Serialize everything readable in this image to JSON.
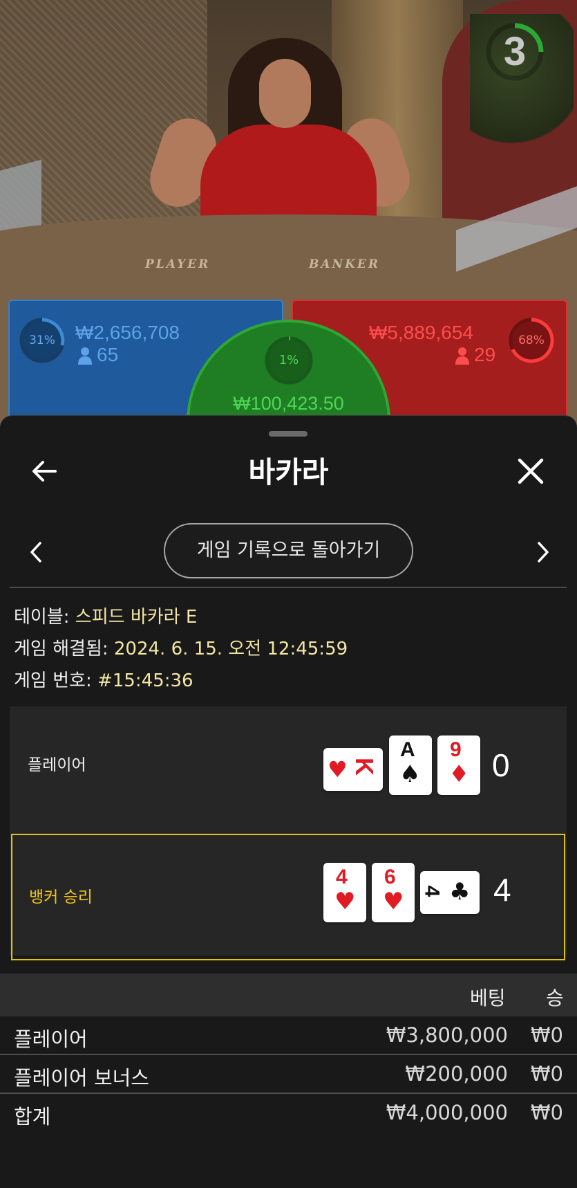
{
  "stage": {
    "countdown": "3",
    "table_labels": {
      "player": "PLAYER",
      "banker": "BANKER"
    },
    "player_pool": {
      "percent": "31%",
      "amount": "₩2,656,708",
      "count": "65"
    },
    "banker_pool": {
      "percent": "68%",
      "amount": "₩5,889,654",
      "count": "29"
    },
    "tie_pool": {
      "percent": "1%",
      "amount": "₩100,423.50"
    }
  },
  "sheet": {
    "title": "바카라",
    "back_icon": "arrow-left-icon",
    "close_icon": "close-icon",
    "return_button": "게임 기록으로 돌아가기",
    "meta": {
      "table_label": "테이블: ",
      "table_value": "스피드 바카라 E",
      "resolved_label": "게임 해결됨: ",
      "resolved_value": "2024. 6. 15. 오전 12:45:59",
      "number_label": "게임 번호: ",
      "number_value": "#15:45:36"
    },
    "result": {
      "player": {
        "label": "플레이어",
        "total": "0",
        "cards": [
          {
            "rank": "K",
            "suit": "♥",
            "color": "red",
            "sideways": true
          },
          {
            "rank": "A",
            "suit": "♠",
            "color": "black",
            "sideways": false
          },
          {
            "rank": "9",
            "suit": "♦",
            "color": "red",
            "sideways": false
          }
        ]
      },
      "banker": {
        "label": "뱅커 승리",
        "label_color": "#f0c419",
        "total": "4",
        "cards": [
          {
            "rank": "4",
            "suit": "♥",
            "color": "red",
            "sideways": false
          },
          {
            "rank": "6",
            "suit": "♥",
            "color": "red",
            "sideways": false
          },
          {
            "rank": "4",
            "suit": "♣",
            "color": "black",
            "sideways": true
          }
        ]
      }
    },
    "bets": {
      "header": {
        "bet": "베팅",
        "win": "승"
      },
      "rows": [
        {
          "name": "플레이어",
          "bet": "₩3,800,000",
          "win": "₩0"
        },
        {
          "name": "플레이어 보너스",
          "bet": "₩200,000",
          "win": "₩0"
        },
        {
          "name": "합계",
          "bet": "₩4,000,000",
          "win": "₩0"
        }
      ]
    }
  },
  "colors": {
    "player_blue": "#1e5a9c",
    "banker_red": "#a51e1e",
    "tie_green": "#1f7d23",
    "highlight": "#e2c213"
  }
}
